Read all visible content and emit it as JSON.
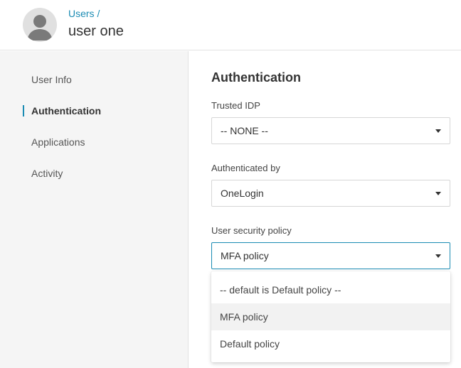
{
  "header": {
    "breadcrumb": "Users /",
    "title": "user one",
    "avatar_icon": "user-avatar-icon"
  },
  "sidebar": {
    "items": [
      {
        "label": "User Info",
        "active": false
      },
      {
        "label": "Authentication",
        "active": true
      },
      {
        "label": "Applications",
        "active": false
      },
      {
        "label": "Activity",
        "active": false
      }
    ]
  },
  "main": {
    "section_title": "Authentication",
    "fields": [
      {
        "label": "Trusted IDP",
        "value": "-- NONE --"
      },
      {
        "label": "Authenticated by",
        "value": "OneLogin"
      },
      {
        "label": "User security policy",
        "value": "MFA policy"
      }
    ],
    "dropdown": {
      "options": [
        "-- default is Default policy --",
        "MFA policy",
        "Default policy"
      ],
      "hovered": "MFA policy"
    }
  },
  "colors": {
    "accent": "#1a8bb3",
    "sidebar_bg": "#f5f5f5",
    "hover_bg": "#f2f2f2"
  }
}
